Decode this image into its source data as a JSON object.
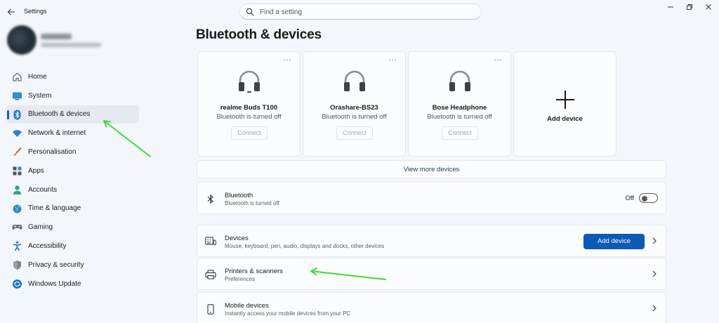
{
  "window": {
    "title": "Settings",
    "search_placeholder": "Find a setting"
  },
  "sidebar": {
    "items": [
      {
        "label": "Home",
        "icon": "home-icon"
      },
      {
        "label": "System",
        "icon": "system-icon"
      },
      {
        "label": "Bluetooth & devices",
        "icon": "bluetooth-icon",
        "selected": true
      },
      {
        "label": "Network & internet",
        "icon": "wifi-icon"
      },
      {
        "label": "Personalisation",
        "icon": "brush-icon"
      },
      {
        "label": "Apps",
        "icon": "apps-icon"
      },
      {
        "label": "Accounts",
        "icon": "person-icon"
      },
      {
        "label": "Time & language",
        "icon": "globe-icon"
      },
      {
        "label": "Gaming",
        "icon": "gamepad-icon"
      },
      {
        "label": "Accessibility",
        "icon": "accessibility-icon"
      },
      {
        "label": "Privacy & security",
        "icon": "shield-icon"
      },
      {
        "label": "Windows Update",
        "icon": "update-icon"
      }
    ]
  },
  "main": {
    "title": "Bluetooth & devices",
    "devices": [
      {
        "name": "realme Buds T100",
        "status": "Bluetooth is turned off",
        "action": "Connect",
        "more": "···"
      },
      {
        "name": "Orashare-BS23",
        "status": "Bluetooth is turned off",
        "action": "Connect",
        "more": "···"
      },
      {
        "name": "Bose Headphone",
        "status": "Bluetooth is turned off",
        "action": "Connect",
        "more": "···"
      }
    ],
    "add_device_card": "Add device",
    "view_more": "View more devices",
    "bluetooth_row": {
      "title": "Bluetooth",
      "subtitle": "Bluetooth is turned off",
      "toggle_label": "Off",
      "toggle_on": false
    },
    "devices_row": {
      "title": "Devices",
      "subtitle": "Mouse, keyboard, pen, audio, displays and docks, other devices",
      "button": "Add device"
    },
    "printers_row": {
      "title": "Printers & scanners",
      "subtitle": "Preferences"
    },
    "mobile_row": {
      "title": "Mobile devices",
      "subtitle": "Instantly access your mobile devices from your PC"
    }
  },
  "colors": {
    "accent": "#0d5ab4",
    "annotation_arrow": "#3ddc3a",
    "background": "#f3f6fb"
  }
}
